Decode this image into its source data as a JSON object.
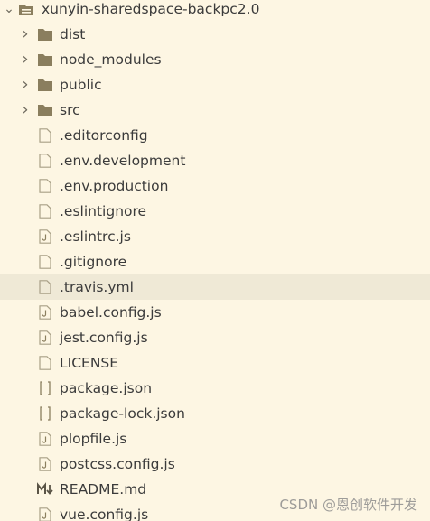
{
  "explorer": {
    "root": {
      "label": "xunyin-sharedspace-backpc2.0",
      "expanded": true,
      "icon": "folder-root-icon"
    },
    "items": [
      {
        "label": "dist",
        "type": "folder",
        "icon": "folder-icon",
        "expanded": false
      },
      {
        "label": "node_modules",
        "type": "folder",
        "icon": "folder-icon",
        "expanded": false
      },
      {
        "label": "public",
        "type": "folder",
        "icon": "folder-icon",
        "expanded": false
      },
      {
        "label": "src",
        "type": "folder",
        "icon": "folder-icon",
        "expanded": false
      },
      {
        "label": ".editorconfig",
        "type": "file",
        "icon": "file-icon"
      },
      {
        "label": ".env.development",
        "type": "file",
        "icon": "file-icon"
      },
      {
        "label": ".env.production",
        "type": "file",
        "icon": "file-icon"
      },
      {
        "label": ".eslintignore",
        "type": "file",
        "icon": "file-icon"
      },
      {
        "label": ".eslintrc.js",
        "type": "file",
        "icon": "js-file-icon"
      },
      {
        "label": ".gitignore",
        "type": "file",
        "icon": "file-icon"
      },
      {
        "label": ".travis.yml",
        "type": "file",
        "icon": "file-icon",
        "selected": true
      },
      {
        "label": "babel.config.js",
        "type": "file",
        "icon": "js-file-icon"
      },
      {
        "label": "jest.config.js",
        "type": "file",
        "icon": "js-file-icon"
      },
      {
        "label": "LICENSE",
        "type": "file",
        "icon": "file-icon"
      },
      {
        "label": "package.json",
        "type": "file",
        "icon": "json-file-icon"
      },
      {
        "label": "package-lock.json",
        "type": "file",
        "icon": "json-file-icon"
      },
      {
        "label": "plopfile.js",
        "type": "file",
        "icon": "js-file-icon"
      },
      {
        "label": "postcss.config.js",
        "type": "file",
        "icon": "js-file-icon"
      },
      {
        "label": "README.md",
        "type": "file",
        "icon": "markdown-file-icon"
      },
      {
        "label": "vue.config.js",
        "type": "file",
        "icon": "js-file-icon"
      }
    ]
  },
  "watermark": {
    "text": "CSDN @恩创软件开发"
  },
  "colors": {
    "background": "#fdf6e3",
    "selected_row": "#efe9d6",
    "folder": "#8a7e5e",
    "file_outline": "#a89f86",
    "text": "#3b3b3b"
  }
}
